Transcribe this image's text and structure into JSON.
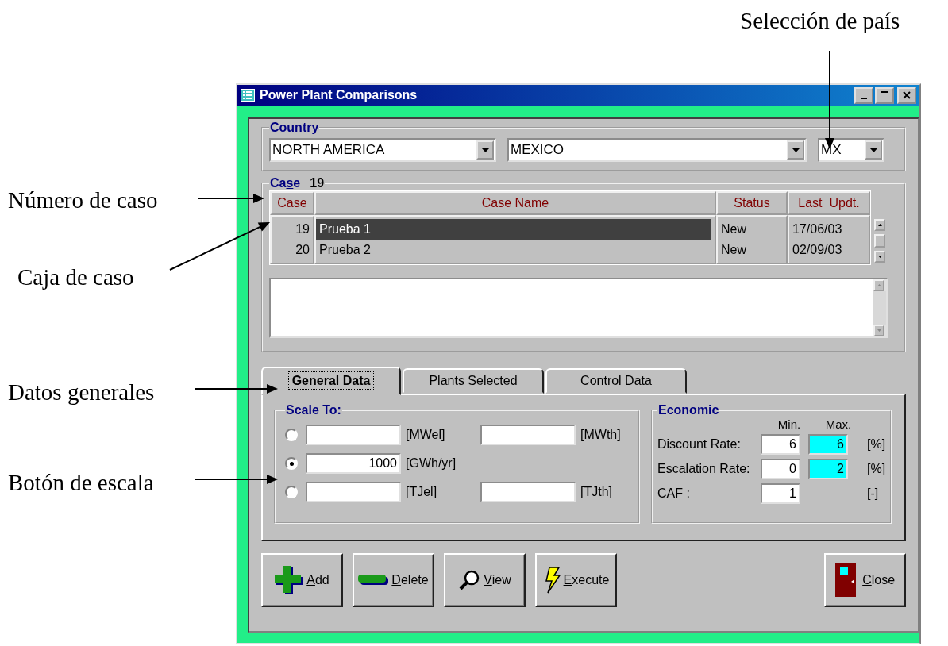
{
  "window": {
    "title": "Power Plant Comparisons"
  },
  "country": {
    "legend": "Country",
    "region": "NORTH AMERICA",
    "country": "MEXICO",
    "code": "MX"
  },
  "case": {
    "legend": "Case",
    "number": "19",
    "columns": [
      "Case",
      "Case Name",
      "Status",
      "Last  Updt."
    ],
    "rows": [
      {
        "case": "19",
        "name": "Prueba 1",
        "status": "New",
        "updated": "17/06/03",
        "selected": true
      },
      {
        "case": "20",
        "name": "Prueba 2",
        "status": "New",
        "updated": "02/09/03",
        "selected": false
      }
    ]
  },
  "tabs": [
    {
      "label": "General Data",
      "selected": true
    },
    {
      "label": "Plants Selected",
      "selected": false
    },
    {
      "label": "Control Data",
      "selected": false
    }
  ],
  "scale": {
    "legend": "Scale To:",
    "rows": [
      {
        "selected": false,
        "fields": [
          {
            "unit": "[MWel]"
          },
          {
            "unit": "[MWth]"
          }
        ]
      },
      {
        "selected": true,
        "fields": [
          {
            "value": "1000",
            "unit": "[GWh/yr]"
          }
        ]
      },
      {
        "selected": false,
        "fields": [
          {
            "unit": "[TJel]"
          },
          {
            "unit": "[TJth]"
          }
        ]
      }
    ]
  },
  "economic": {
    "legend": "Economic",
    "min_header": "Min.",
    "max_header": "Max.",
    "rows": [
      {
        "label": "Discount Rate:",
        "fields": [
          {
            "value": "6",
            "highlighted": false
          },
          {
            "value": "6",
            "highlighted": true
          }
        ],
        "unit": "[%]"
      },
      {
        "label": "Escalation Rate:",
        "fields": [
          {
            "value": "0",
            "highlighted": false
          },
          {
            "value": "2",
            "highlighted": true
          }
        ],
        "unit": "[%]"
      },
      {
        "label": "CAF :",
        "fields": [
          {
            "value": "1",
            "highlighted": false
          }
        ],
        "unit": "[-]"
      }
    ]
  },
  "buttons": [
    {
      "label": "Add"
    },
    {
      "label": "Delete"
    },
    {
      "label": "View"
    },
    {
      "label": "Execute"
    },
    {
      "label": "Close"
    }
  ],
  "annotations": [
    {
      "text": "Selección de país"
    },
    {
      "text": "Número de caso"
    },
    {
      "text": "Caja de caso"
    },
    {
      "text": "Datos generales"
    },
    {
      "text": "Botón de escala"
    }
  ]
}
